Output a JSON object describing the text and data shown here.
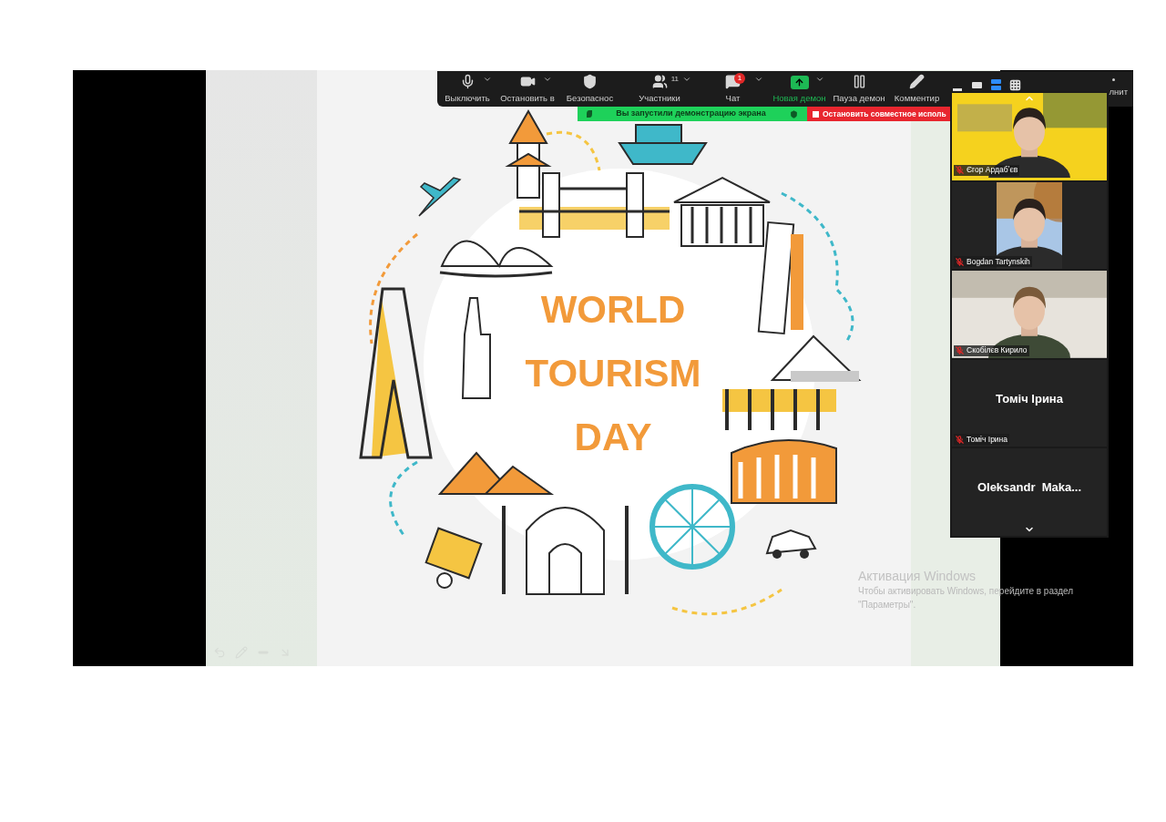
{
  "toolbar": {
    "buttons": [
      {
        "kind": "mic",
        "label": "Выключить",
        "has_menu": true
      },
      {
        "kind": "video",
        "label": "Остановить в",
        "has_menu": true
      },
      {
        "kind": "security",
        "label": "Безопаснос",
        "has_menu": false
      },
      {
        "kind": "participants",
        "label": "Участники",
        "has_menu": true,
        "count": "11"
      },
      {
        "kind": "chat",
        "label": "Чат",
        "has_menu": true,
        "badge": "1"
      },
      {
        "kind": "share",
        "label": "Новая демон",
        "has_menu": true
      },
      {
        "kind": "pause",
        "label": "Пауза демон",
        "has_menu": false
      },
      {
        "kind": "annotate",
        "label": "Комментир",
        "has_menu": false
      }
    ],
    "view_modes": [
      {
        "kind": "minimize",
        "selected": false
      },
      {
        "kind": "thumbnail",
        "selected": false
      },
      {
        "kind": "speaker",
        "selected": true
      },
      {
        "kind": "gallery",
        "selected": false
      }
    ],
    "more_label": "лнит"
  },
  "share_banner": {
    "message": "Вы запустили демонстрацию экрана",
    "stop_button": "Остановить совместное исполь"
  },
  "slide": {
    "title_lines": [
      "WORLD",
      "TOURISM",
      "DAY"
    ]
  },
  "participants": [
    {
      "kind": "video",
      "name": "Єгор Ардабʼєв",
      "muted": true,
      "active_speaker": true
    },
    {
      "kind": "video",
      "name": "Bogdan Tartynskih",
      "muted": true,
      "active_speaker": false
    },
    {
      "kind": "video",
      "name": "Скобілєв Кирило",
      "muted": true,
      "active_speaker": false
    },
    {
      "kind": "avatar",
      "display_name": "Томіч Ірина",
      "name": "Томіч Ірина",
      "muted": true,
      "active_speaker": false
    },
    {
      "kind": "avatar",
      "display_name": "Oleksandr  Maka...",
      "active_speaker": false
    }
  ],
  "activation": {
    "title": "Активация Windows",
    "lines": [
      "Чтобы активировать Windows, перейдите в раздел",
      "\"Параметры\"."
    ]
  }
}
